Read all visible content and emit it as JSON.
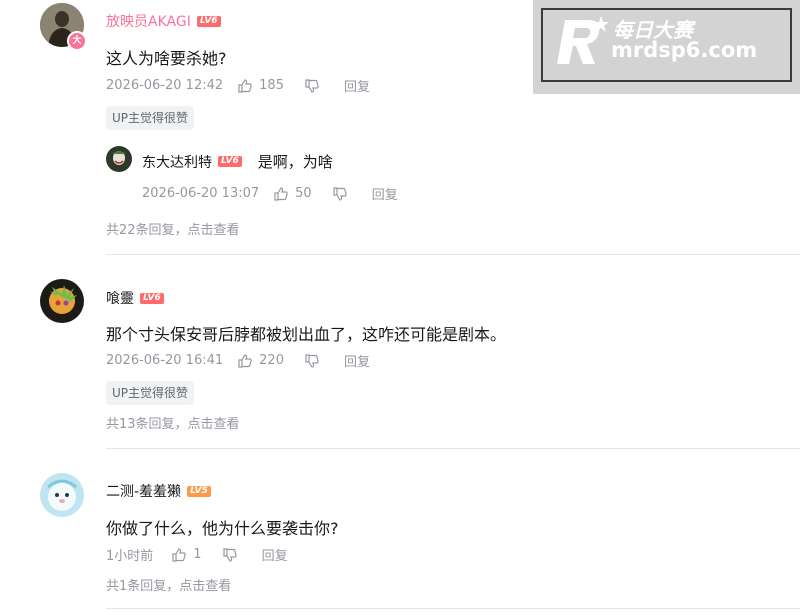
{
  "watermark": {
    "line1": "每日大赛",
    "line2": "mrdsp6.com"
  },
  "comments": [
    {
      "user": "放映员AKAGI",
      "level": "LV6",
      "text": "这人为啥要杀她?",
      "time": "2026-06-20 12:42",
      "likes": "185",
      "reply_label": "回复",
      "tag": "UP主觉得很赞",
      "reply": {
        "user": "东大达利特",
        "level": "LV6",
        "text": "是啊，为啥",
        "time": "2026-06-20 13:07",
        "likes": "50",
        "reply_label": "回复"
      },
      "more": "共22条回复，点击查看"
    },
    {
      "user": "喰靈",
      "level": "LV6",
      "text": "那个寸头保安哥后脖都被划出血了，这咋还可能是剧本。",
      "time": "2026-06-20 16:41",
      "likes": "220",
      "reply_label": "回复",
      "tag": "UP主觉得很赞",
      "more": "共13条回复，点击查看"
    },
    {
      "user": "二测-羞羞獭",
      "level": "LV5",
      "text": "你做了什么，他为什么要袭击你?",
      "time": "1小时前",
      "likes": "1",
      "reply_label": "回复",
      "more": "共1条回复，点击查看"
    }
  ]
}
